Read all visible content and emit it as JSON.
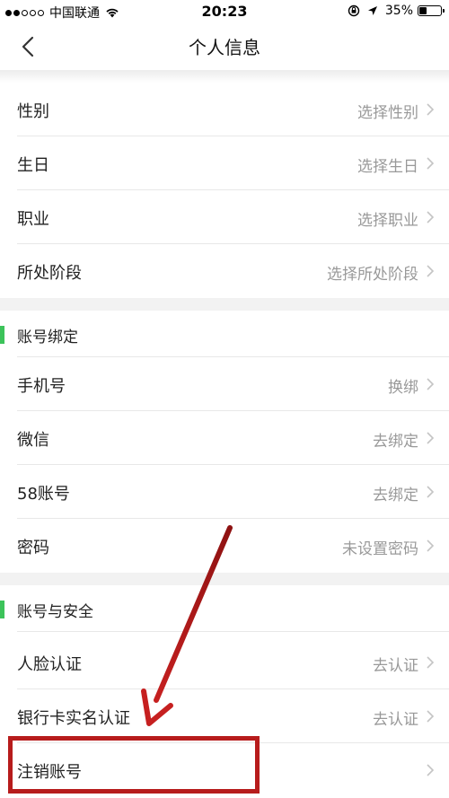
{
  "status_bar": {
    "carrier": "中国联通",
    "time": "20:23",
    "battery": "35%",
    "battery_level": 0.35,
    "signal_bars": 2,
    "icons": [
      "signal-dots-icon",
      "wifi-icon",
      "orientation-lock-icon",
      "location-arrow-icon",
      "battery-icon"
    ]
  },
  "nav": {
    "title": "个人信息",
    "back_icon": "back-chevron-icon"
  },
  "profile_rows": [
    {
      "label": "性别",
      "value": "选择性别"
    },
    {
      "label": "生日",
      "value": "选择生日"
    },
    {
      "label": "职业",
      "value": "选择职业"
    },
    {
      "label": "所处阶段",
      "value": "选择所处阶段"
    }
  ],
  "binding_section": {
    "title": "账号绑定",
    "rows": [
      {
        "label": "手机号",
        "value": "换绑"
      },
      {
        "label": "微信",
        "value": "去绑定"
      },
      {
        "label": "58账号",
        "value": "去绑定"
      },
      {
        "label": "密码",
        "value": "未设置密码"
      }
    ]
  },
  "security_section": {
    "title": "账号与安全",
    "rows": [
      {
        "label": "人脸认证",
        "value": "去认证"
      },
      {
        "label": "银行卡实名认证",
        "value": "去认证"
      },
      {
        "label": "注销账号",
        "value": ""
      }
    ]
  },
  "colors": {
    "accent_green": "#3cc35a",
    "annotation_red": "#b71c1c",
    "value_gray": "#999999",
    "section_gap": "#f2f2f2"
  },
  "annotation": {
    "type": "arrow-and-box",
    "target": "注销账号"
  }
}
